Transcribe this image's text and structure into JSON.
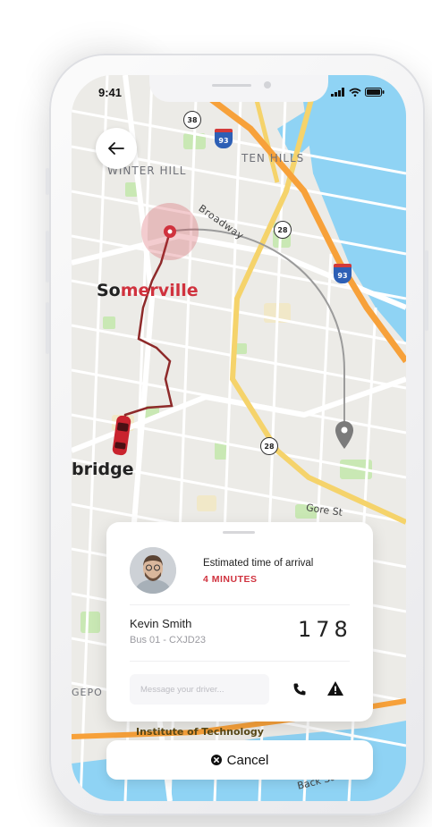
{
  "status_bar": {
    "time": "9:41"
  },
  "map": {
    "labels": {
      "winter_hill": "WINTER HILL",
      "ten_hills": "TEN HILLS",
      "broadway": "Broadway",
      "gore_st": "Gore St",
      "back_st": "Back St",
      "institute": "Institute of Technology",
      "gepo": "GEPO",
      "bridge": "bridge",
      "somerville_dark": "So",
      "somerville_red": "merville"
    },
    "shields": {
      "r38": "38",
      "r28a": "28",
      "r28b": "28",
      "i93a": "93",
      "i93b": "93"
    },
    "colors": {
      "route": "#8e2a2a",
      "highlight": "#d0323e",
      "water": "#8fd3f4",
      "highway": "#f7a13a",
      "road_yellow": "#f5d36b"
    }
  },
  "trip": {
    "eta_label": "Estimated time of arrival",
    "eta_value": "4 MINUTES",
    "driver_name": "Kevin Smith",
    "bus_info": "Bus 01 - CXJD23",
    "plate_number": "178",
    "message_placeholder": "Message your driver..."
  },
  "actions": {
    "cancel_label": "Cancel"
  },
  "icons": [
    "back-arrow-icon",
    "signal-icon",
    "wifi-icon",
    "battery-icon",
    "phone-icon",
    "warning-icon",
    "close-circle-icon",
    "destination-pin-icon",
    "pickup-pin-icon",
    "car-icon"
  ]
}
